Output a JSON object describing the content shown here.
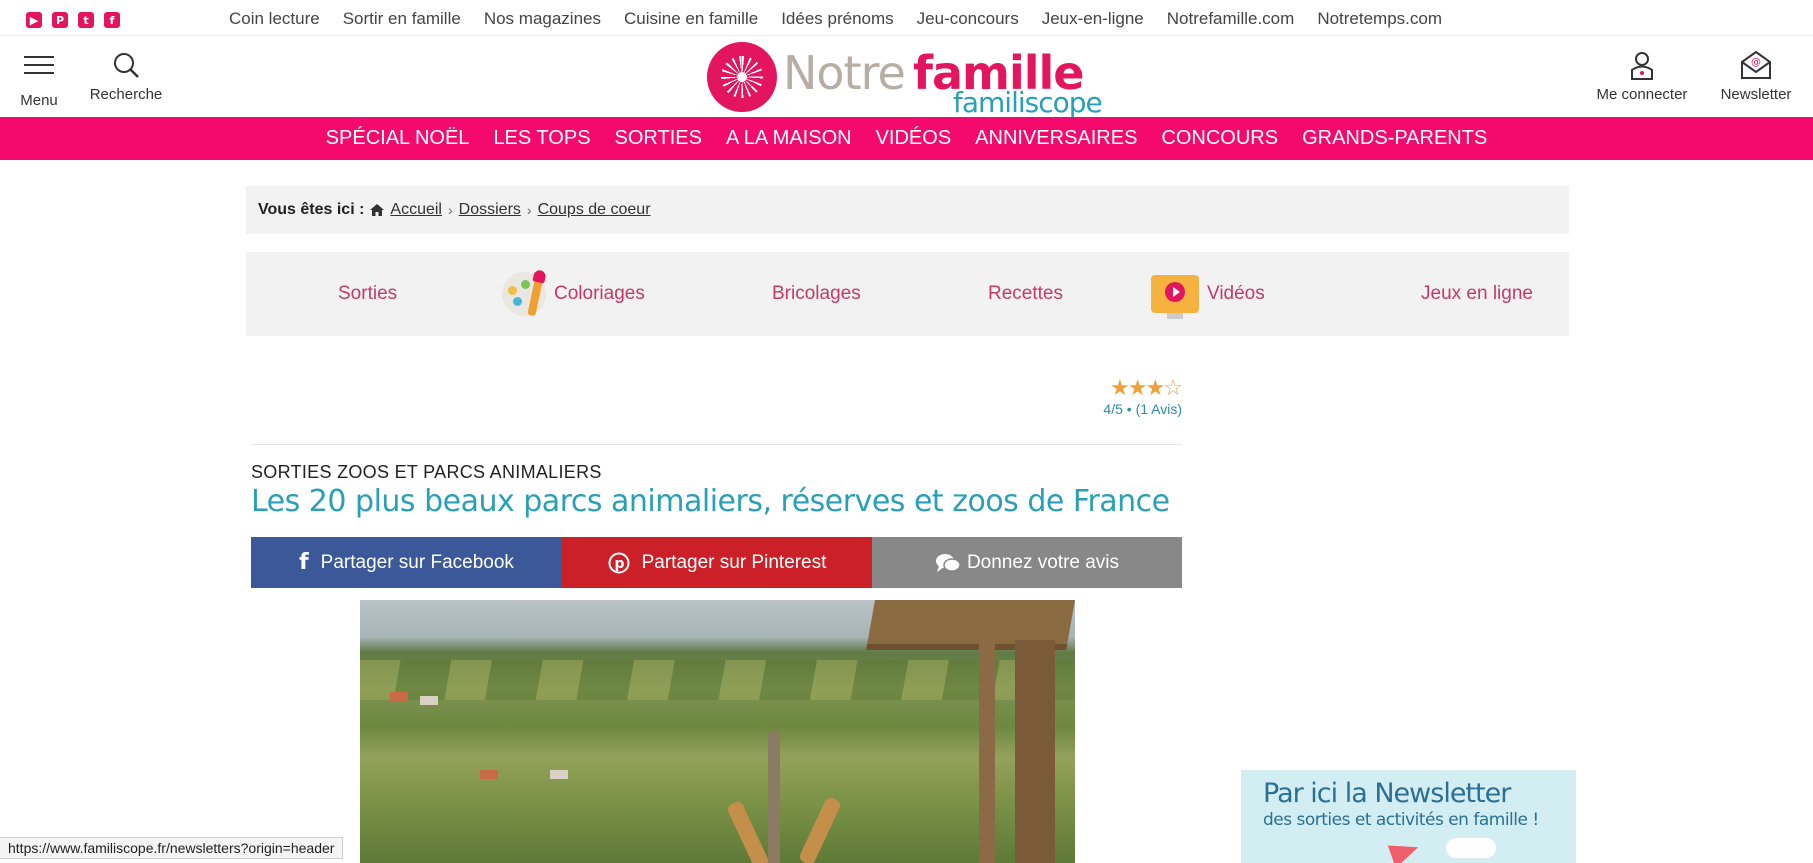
{
  "social": {
    "icons": [
      {
        "name": "youtube-icon",
        "glyph": "▶"
      },
      {
        "name": "pinterest-icon",
        "glyph": "P"
      },
      {
        "name": "twitter-icon",
        "glyph": "t"
      },
      {
        "name": "facebook-icon",
        "glyph": "f"
      }
    ]
  },
  "toplinks": [
    "Coin lecture",
    "Sortir en famille",
    "Nos magazines",
    "Cuisine en famille",
    "Idées prénoms",
    "Jeu-concours",
    "Jeux-en-ligne",
    "Notrefamille.com",
    "Notretemps.com"
  ],
  "header": {
    "menu_label": "Menu",
    "search_label": "Recherche",
    "login_label": "Me connecter",
    "newsletter_label": "Newsletter",
    "logo": {
      "part1": "Notre",
      "part2": "famille",
      "part3": "familiscope"
    }
  },
  "mainnav": [
    "SPÉCIAL NOËL",
    "LES TOPS",
    "SORTIES",
    "A LA MAISON",
    "VIDÉOS",
    "ANNIVERSAIRES",
    "CONCOURS",
    "GRANDS-PARENTS"
  ],
  "breadcrumb": {
    "prefix": "Vous êtes ici :",
    "items": [
      "Accueil",
      "Dossiers",
      "Coups de coeur"
    ],
    "separator": "›"
  },
  "categories": [
    {
      "label": "Sorties",
      "icon": null
    },
    {
      "label": "Coloriages",
      "icon": "palette-icon"
    },
    {
      "label": "Bricolages",
      "icon": null
    },
    {
      "label": "Recettes",
      "icon": null
    },
    {
      "label": "Vidéos",
      "icon": "video-monitor-icon"
    },
    {
      "label": "Jeux en ligne",
      "icon": null
    }
  ],
  "rating": {
    "stars_filled": 3,
    "stars_total": 4,
    "text": "4/5 • (1 Avis)"
  },
  "article": {
    "kicker": "SORTIES ZOOS ET PARCS ANIMALIERS",
    "title": "Les 20 plus beaux parcs animaliers, réserves et zoos de France"
  },
  "share": {
    "facebook": "Partager sur Facebook",
    "pinterest": "Partager sur Pinterest",
    "avis": "Donnez votre avis"
  },
  "newsletter_banner": {
    "line1": "Par ici la Newsletter",
    "line2": "des sorties et activités en famille !"
  },
  "statusbar": {
    "url": "https://www.familiscope.fr/newsletters?origin=header"
  },
  "colors": {
    "brand_pink": "#f40a6c",
    "accent_teal": "#2a9fb8",
    "facebook": "#3b5998",
    "pinterest": "#cb2027"
  }
}
